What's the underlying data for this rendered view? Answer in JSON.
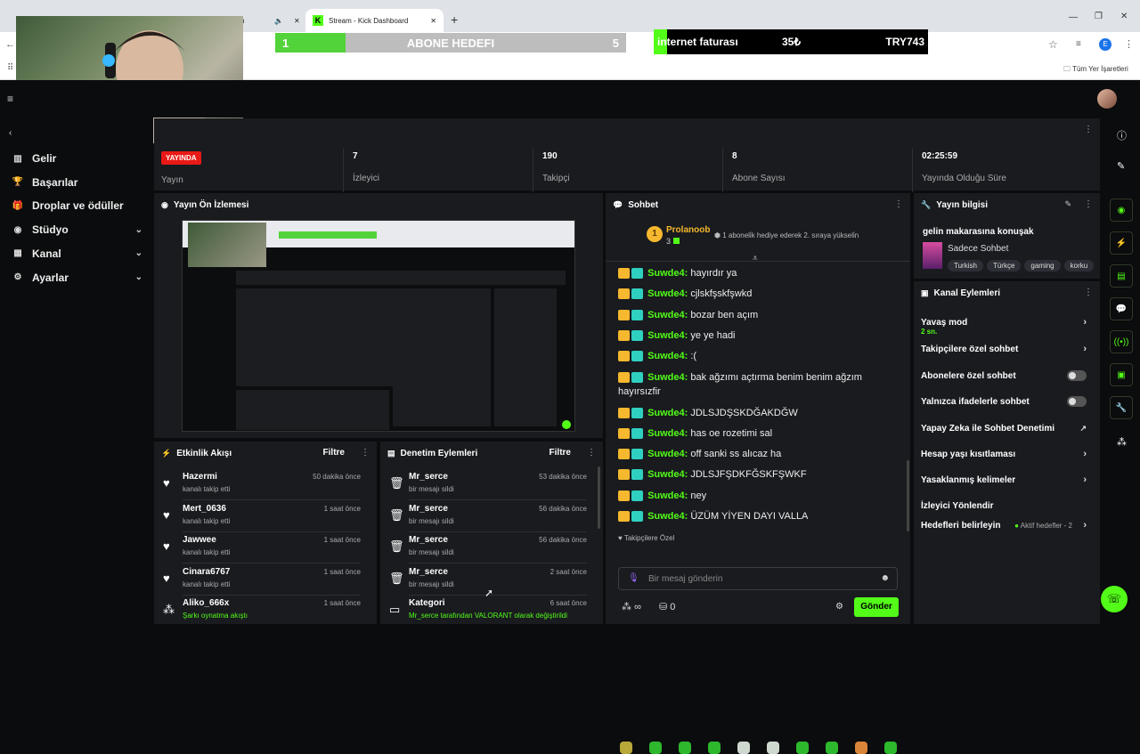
{
  "browser": {
    "tabs": [
      {
        "label": "n"
      },
      {
        "label": "Stream - Kick Dashboard"
      }
    ],
    "new_tab": "+",
    "bookmarks_label": "Tüm Yer İşaretleri",
    "profile_initial": "E"
  },
  "goals": {
    "sub_goal": {
      "start": "1",
      "label": "ABONE HEDEFI",
      "end": "5",
      "progress": 0.2
    },
    "bill_goal": {
      "label": "internet faturası",
      "current": "35₺",
      "target": "TRY743",
      "progress": 0.05
    }
  },
  "sidebar": {
    "items": [
      {
        "label": "Gelir",
        "icon": "chart-icon",
        "chevron": false
      },
      {
        "label": "Başarılar",
        "icon": "trophy-icon",
        "chevron": false
      },
      {
        "label": "Droplar ve ödüller",
        "icon": "gift-icon",
        "chevron": false
      },
      {
        "label": "Stüdyo",
        "icon": "studio-icon",
        "chevron": true
      },
      {
        "label": "Kanal",
        "icon": "channel-icon",
        "chevron": true
      },
      {
        "label": "Ayarlar",
        "icon": "gear-icon",
        "chevron": true
      }
    ]
  },
  "stats": {
    "live_badge": "YAYINDA",
    "live_label": "Yayın",
    "viewers": {
      "value": "7",
      "label": "İzleyici"
    },
    "followers": {
      "value": "190",
      "label": "Takipçi"
    },
    "subs": {
      "value": "8",
      "label": "Abone Sayısı"
    },
    "uptime": {
      "value": "02:25:59",
      "label": "Yayında Olduğu Süre"
    }
  },
  "preview": {
    "title": "Yayın Ön İzlemesi"
  },
  "activity": {
    "title": "Etkinlik Akışı",
    "filter": "Filtre",
    "items": [
      {
        "name": "Hazermi",
        "sub": "kanalı takip etti",
        "time": "50 dakika önce"
      },
      {
        "name": "Mert_0636",
        "sub": "kanalı takip etti",
        "time": "1 saat önce"
      },
      {
        "name": "Jawwee",
        "sub": "kanalı takip etti",
        "time": "1 saat önce"
      },
      {
        "name": "Cinara6767",
        "sub": "kanalı takip etti",
        "time": "1 saat önce"
      },
      {
        "name": "Aliko_666x",
        "sub": "Şarkı oynatma akıştı",
        "time": "1 saat önce"
      }
    ]
  },
  "moderation": {
    "title": "Denetim Eylemleri",
    "filter": "Filtre",
    "items": [
      {
        "name": "Mr_serce",
        "sub": "bir mesajı sildi",
        "time": "53 dakika önce"
      },
      {
        "name": "Mr_serce",
        "sub": "bir mesajı sildi",
        "time": "56 dakika önce"
      },
      {
        "name": "Mr_serce",
        "sub": "bir mesajı sildi",
        "time": "56 dakika önce"
      },
      {
        "name": "Mr_serce",
        "sub": "bir mesajı sildi",
        "time": "2 saat önce"
      },
      {
        "name": "Kategori",
        "sub": "Mr_serce tarafından VALORANT olarak değiştirildi",
        "time": "6 saat önce"
      }
    ]
  },
  "chat": {
    "title": "Sohbet",
    "pinned": {
      "rank": "1",
      "user": "Prolanoob",
      "count": "3",
      "text": "1 aboneli̇k hediye ederek 2. sıraya yükseli̇n"
    },
    "messages": [
      {
        "user": "Suwde4:",
        "text": "hayırdır ya"
      },
      {
        "user": "Suwde4:",
        "text": "cjlskfşskfşwkd"
      },
      {
        "user": "Suwde4:",
        "text": "bozar ben açım"
      },
      {
        "user": "Suwde4:",
        "text": "ye ye hadi"
      },
      {
        "user": "Suwde4:",
        "text": ":("
      },
      {
        "user": "Suwde4:",
        "text": "bak ağzımı açtırma benim benim ağzım hayırsızfir"
      },
      {
        "user": "Suwde4:",
        "text": "JDLSJDŞSKDĞAKDĞW"
      },
      {
        "user": "Suwde4:",
        "text": "has oe rozetimi sal"
      },
      {
        "user": "Suwde4:",
        "text": "off sanki ss alıcaz ha"
      },
      {
        "user": "Suwde4:",
        "text": "JDLSJFŞDKFĞSKFŞWKF"
      },
      {
        "user": "Suwde4:",
        "text": "ney"
      },
      {
        "user": "Suwde4:",
        "text": "ÜZÜM YİYEN DAYI VALLA"
      }
    ],
    "mode_label": "Takipçilere Özel",
    "input_placeholder": "Bir mesaj gönderin",
    "points": "0",
    "send": "Gönder",
    "infinity": "∞"
  },
  "stream_info": {
    "title": "Yayın bilgisi",
    "stream_title": "gelin makarasına konuşak",
    "category": "Sadece Sohbet",
    "tags": [
      "Turkish",
      "Türkçe",
      "gaming",
      "korku"
    ]
  },
  "channel_actions": {
    "title": "Kanal Eylemleri",
    "items": [
      {
        "label": "Yavaş mod",
        "sub": "2 sn.",
        "control": "chevron"
      },
      {
        "label": "Takipçilere özel sohbet",
        "control": "chevron"
      },
      {
        "label": "Abonelere özel sohbet",
        "control": "toggle"
      },
      {
        "label": "Yalnızca ifadelerle sohbet",
        "control": "toggle"
      },
      {
        "label": "Yapay Zeka ile Sohbet Denetimi",
        "control": "external"
      },
      {
        "label": "Hesap yaşı kısıtlaması",
        "control": "chevron"
      },
      {
        "label": "Yasaklanmış kelimeler",
        "control": "chevron"
      },
      {
        "label": "İzleyici Yönlendir",
        "control": "none"
      },
      {
        "label": "Hedefleri belirleyin",
        "badge": "Aktif hedefler - 2",
        "control": "chevron"
      }
    ]
  }
}
